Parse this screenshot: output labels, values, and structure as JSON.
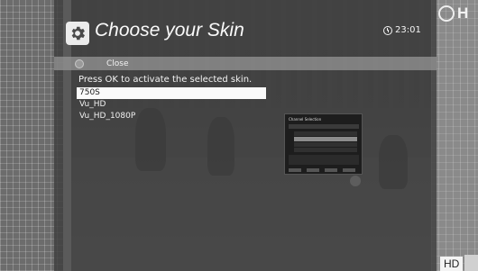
{
  "header": {
    "title": "Choose your Skin",
    "clock": "23:01",
    "logo_text": "H"
  },
  "button_bar": {
    "close_label": "Close"
  },
  "instruction": "Press OK to activate the selected skin.",
  "skins": [
    {
      "label": "750S",
      "selected": true
    },
    {
      "label": "Vu_HD",
      "selected": false
    },
    {
      "label": "Vu_HD_1080P",
      "selected": false
    }
  ],
  "preview": {
    "header": "Channel Selection"
  },
  "badge": {
    "hd": "HD"
  },
  "colors": {
    "panel": "#3e3e3e",
    "selection": "#fafafa",
    "button_bar": "#969696"
  }
}
